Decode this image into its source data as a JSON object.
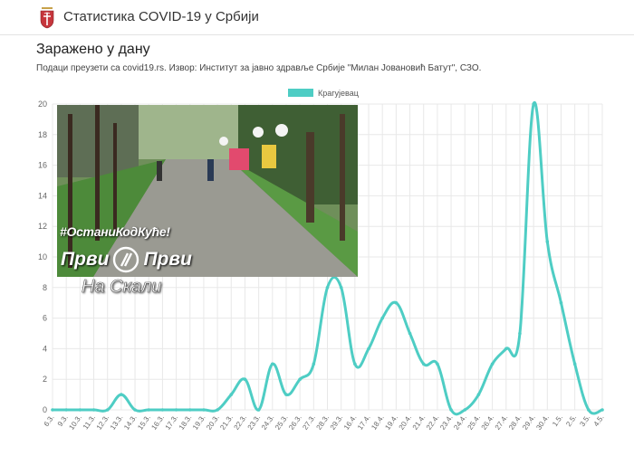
{
  "header": {
    "title": "Статистика COVID-19 у Србији",
    "crest_icon": "serbian-coat-of-arms-icon"
  },
  "page": {
    "title": "Заражено у дану",
    "subtitle": "Подаци преузети са covid19.rs. Извор: Институт за јавно здравље Србије \"Милан Јовановић Батут\", СЗО."
  },
  "overlay": {
    "caption": "#ОстаниКодКуће!",
    "brand_left": "Први",
    "brand_right": "Први",
    "brand_sub": "На Скали",
    "logo_icon": "pravi-logo-icon"
  },
  "colors": {
    "series": "#4ecdc4",
    "grid": "#e8e8e8"
  },
  "chart_data": {
    "type": "line",
    "title": "",
    "xlabel": "",
    "ylabel": "",
    "ylim": [
      0,
      20
    ],
    "yticks": [
      0,
      2,
      4,
      6,
      8,
      10,
      12,
      14,
      16,
      18,
      20
    ],
    "grid": true,
    "legend_position": "top-center",
    "x": [
      "6.3.",
      "9.3.",
      "10.3.",
      "11.3.",
      "12.3.",
      "13.3.",
      "14.3.",
      "15.3.",
      "16.3.",
      "17.3.",
      "18.3.",
      "19.3.",
      "20.3.",
      "21.3.",
      "22.3.",
      "23.3.",
      "24.3.",
      "25.3.",
      "26.3.",
      "27.3.",
      "28.3.",
      "29.3.",
      "16.4.",
      "17.4.",
      "18.4.",
      "19.4.",
      "20.4.",
      "21.4.",
      "22.4.",
      "23.4.",
      "24.4.",
      "25.4.",
      "26.4.",
      "27.4.",
      "28.4.",
      "29.4.",
      "30.4.",
      "1.5.",
      "2.5.",
      "3.5.",
      "4.5."
    ],
    "series": [
      {
        "name": "Крагујевац",
        "values": [
          0,
          0,
          0,
          0,
          0,
          1,
          0,
          0,
          0,
          0,
          0,
          0,
          0,
          1,
          2,
          0,
          3,
          1,
          2,
          3,
          8,
          8,
          3,
          4,
          6,
          7,
          5,
          3,
          3,
          0,
          0,
          1,
          3,
          4,
          5,
          20,
          11,
          7,
          3,
          0,
          0
        ]
      }
    ]
  }
}
